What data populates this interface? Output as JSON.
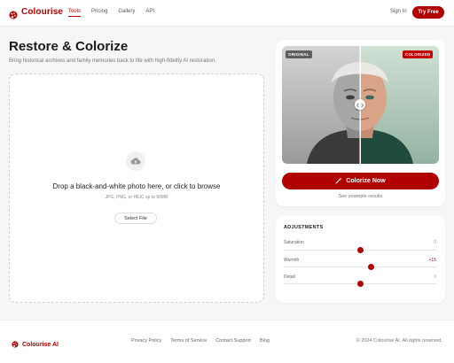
{
  "app": {
    "brand": "Colourise",
    "accent_color": "#b00000"
  },
  "header": {
    "nav": [
      {
        "label": "Tools",
        "active": true
      },
      {
        "label": "Pricing",
        "active": false
      },
      {
        "label": "Gallery",
        "active": false
      },
      {
        "label": "API",
        "active": false
      }
    ],
    "signin_label": "Sign In",
    "cta_label": "Try Free"
  },
  "hero": {
    "title": "Restore & Colorize",
    "subtitle": "Bring historical archives and family memories back to life with high-fidelity AI restoration."
  },
  "dropzone": {
    "icon": "cloud-upload-icon",
    "title": "Drop a black-and-white photo here, or click to browse",
    "hint": "JPG, PNG, or HEIC up to 50MB",
    "button_label": "Select File"
  },
  "preview": {
    "badge_original": "ORIGINAL",
    "badge_colorized": "COLORIZED",
    "divider_position_pct": 50,
    "action_label": "Colorize Now",
    "examples_label": "See example results"
  },
  "adjustments": {
    "title": "ADJUSTMENTS",
    "controls": [
      {
        "label": "Saturation",
        "value": "0",
        "level_pct": 50,
        "accent": false
      },
      {
        "label": "Warmth",
        "value": "+15",
        "level_pct": 57,
        "accent": true
      },
      {
        "label": "Detail",
        "value": "0",
        "level_pct": 50,
        "accent": false
      }
    ]
  },
  "footer": {
    "brand": "Colourise AI",
    "links": [
      "Privacy Policy",
      "Terms of Service",
      "Contact Support",
      "Blog"
    ],
    "copyright": "© 2024 Colourise AI. All rights reserved."
  }
}
